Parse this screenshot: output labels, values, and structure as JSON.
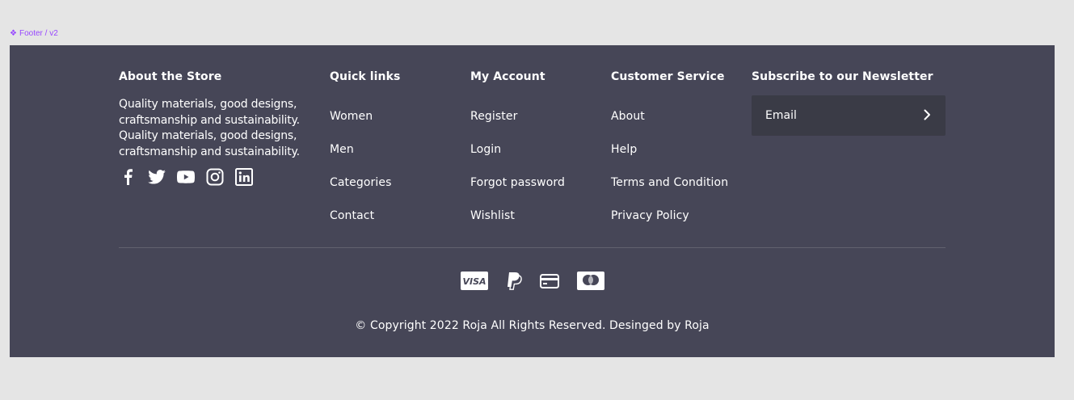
{
  "frame_label": "Footer / v2",
  "about": {
    "title": "About the Store",
    "text": "Quality materials, good designs, craftsmanship and sustainability. Quality materials, good designs, craftsmanship and sustainability.",
    "socials": [
      "facebook-icon",
      "twitter-icon",
      "youtube-icon",
      "instagram-icon",
      "linkedin-icon"
    ]
  },
  "quick_links": {
    "title": "Quick links",
    "items": [
      "Women",
      "Men",
      "Categories",
      "Contact"
    ]
  },
  "my_account": {
    "title": "My Account",
    "items": [
      "Register",
      "Login",
      "Forgot password",
      "Wishlist"
    ]
  },
  "customer_service": {
    "title": "Customer Service",
    "items": [
      "About",
      "Help",
      "Terms and Condition",
      "Privacy Policy"
    ]
  },
  "newsletter": {
    "title": "Subscribe to our Newsletter",
    "email_placeholder": "Email"
  },
  "payments": [
    "visa-icon",
    "paypal-icon",
    "credit-card-icon",
    "mastercard-icon"
  ],
  "copyright": "© Copyright 2022 Roja All Rights Reserved. Desinged by Roja",
  "colors": {
    "footer_bg": "#464657",
    "input_bg": "#3a3b46",
    "divider": "#62626f",
    "frame_label": "#9747ff"
  }
}
